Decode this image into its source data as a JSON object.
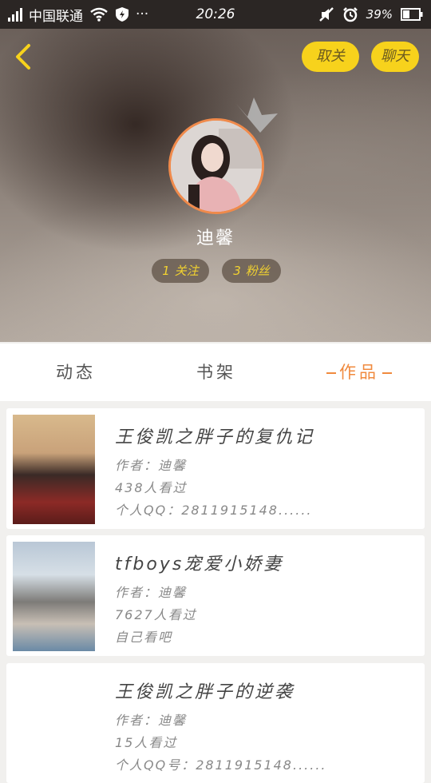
{
  "status_bar": {
    "carrier": "中国联通",
    "time": "20:26",
    "battery": "39%",
    "dots": "···"
  },
  "header": {
    "follow_label": "取关",
    "chat_label": "聊天",
    "username": "迪馨",
    "follow_count": "1",
    "follow_text": "关注",
    "fans_count": "3",
    "fans_text": "粉丝"
  },
  "tabs": [
    {
      "label": "动态"
    },
    {
      "label": "书架"
    },
    {
      "label": "作品",
      "active": true
    }
  ],
  "works": [
    {
      "title": "王俊凯之胖子的复仇记",
      "author": "作者：迪馨",
      "views": "438人看过",
      "desc": "个人QQ：2811915148......"
    },
    {
      "title": "tfboys宠爱小娇妻",
      "author": "作者：迪馨",
      "views": "7627人看过",
      "desc": "自己看吧"
    },
    {
      "title": "王俊凯之胖子的逆袭",
      "author": "作者：迪馨",
      "views": "15人看过",
      "desc": "个人QQ号：2811915148......"
    }
  ],
  "colors": {
    "accent_yellow": "#f7d21c",
    "accent_orange": "#f08a3e",
    "status_bar": "#2b2624"
  }
}
